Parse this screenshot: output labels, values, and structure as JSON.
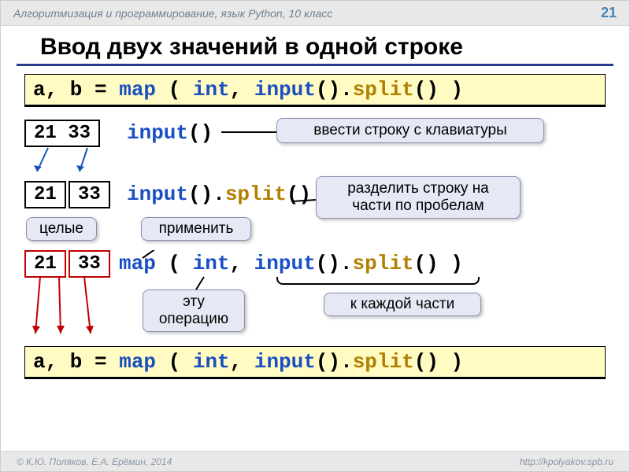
{
  "header": {
    "course": "Алгоритмизация и программирование, язык Python, 10 класс",
    "page": "21"
  },
  "title": "Ввод двух значений в одной строке",
  "code_top": {
    "t_ab": "a, b = ",
    "t_map": "map",
    "t_lp": " ( ",
    "t_int": "int",
    "t_c": ", ",
    "t_input": "input",
    "t_par": "().",
    "t_split": "split",
    "t_end": "() )"
  },
  "step1": {
    "box": "21 33",
    "c_input": "input",
    "c_par": "()",
    "callout": "ввести строку с клавиатуры"
  },
  "step2": {
    "box1": "21",
    "box2": "33",
    "c_input": "input",
    "c_par": "().",
    "c_split": "split",
    "c_end": "()",
    "callout": "разделить строку на части по пробелам"
  },
  "step3": {
    "box1": "21",
    "box2": "33",
    "c_map": "map",
    "c_lp": " ( ",
    "c_int": "int",
    "c_c": ", ",
    "c_input": "input",
    "c_par": "().",
    "c_split": "split",
    "c_end": "() )",
    "label_int": "целые",
    "label_apply": "применить",
    "label_op": "эту операцию",
    "label_each": "к каждой части"
  },
  "code_bottom": {
    "t_ab": "a, b = ",
    "t_map": "map",
    "t_lp": " ( ",
    "t_int": "int",
    "t_c": ", ",
    "t_input": "input",
    "t_par": "().",
    "t_split": "split",
    "t_end": "() )"
  },
  "footer": {
    "copyright": "© К.Ю. Поляков, Е.А. Ерёмин, 2014",
    "url": "http://kpolyakov.spb.ru"
  }
}
